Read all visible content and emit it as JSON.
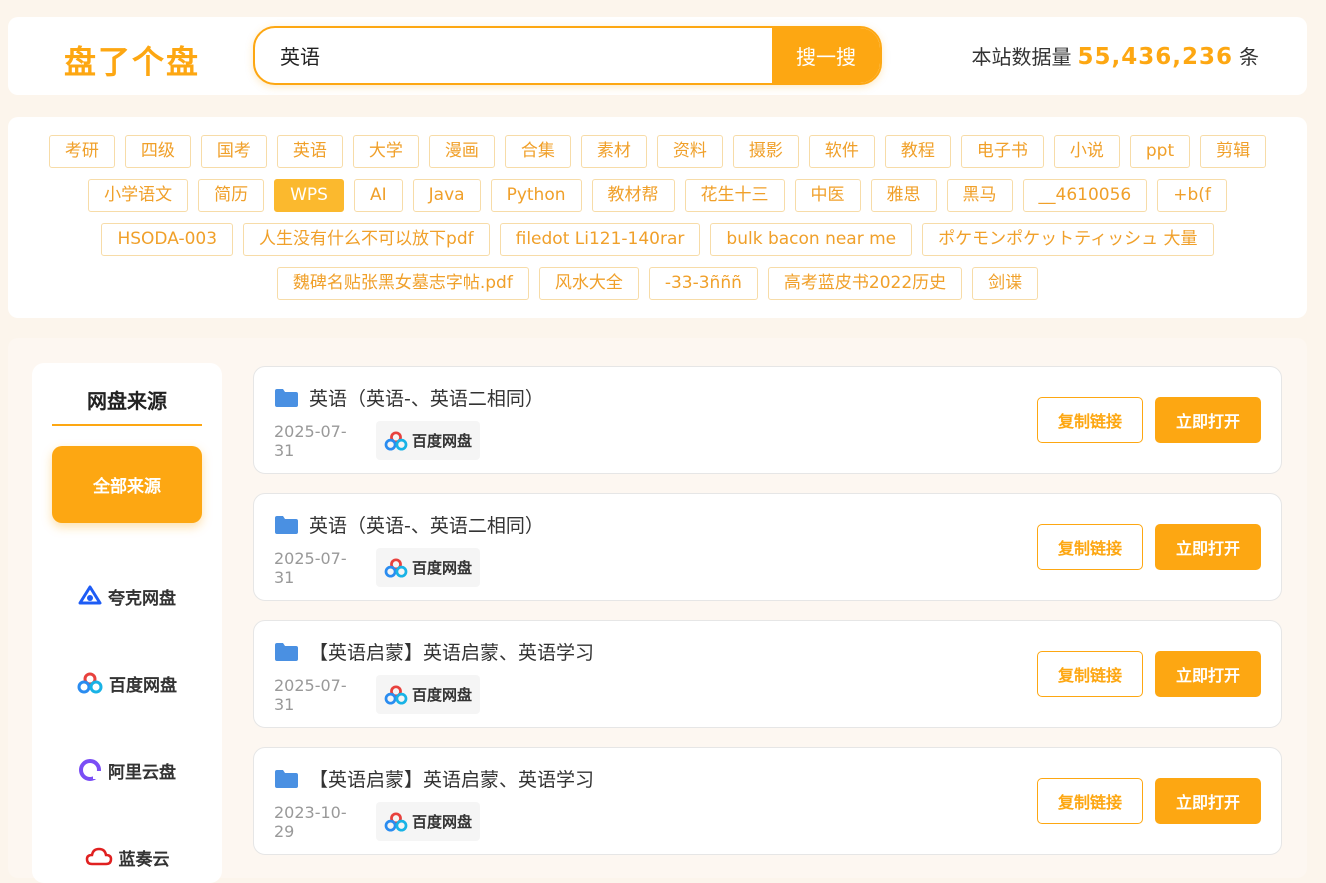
{
  "header": {
    "logo": "盘了个盘",
    "search_value": "英语",
    "search_button": "搜一搜",
    "stats_prefix": "本站数据量",
    "stats_count": "55,436,236",
    "stats_suffix": "条"
  },
  "tags": {
    "rows": [
      [
        "考研",
        "四级",
        "国考",
        "英语",
        "大学",
        "漫画",
        "合集",
        "素材",
        "资料",
        "摄影",
        "软件",
        "教程",
        "电子书",
        "小说",
        "ppt",
        "剪辑"
      ],
      [
        "小学语文",
        "简历",
        "WPS",
        "AI",
        "Java",
        "Python",
        "教材帮",
        "花生十三",
        "中医",
        "雅思",
        "黑马",
        "__4610056",
        "+b(f"
      ],
      [
        "HSODA-003",
        "人生没有什么不可以放下pdf",
        "filedot Li121-140rar",
        "bulk bacon near me",
        "ポケモンポケットティッシュ 大量"
      ],
      [
        "魏碑名贴张黑女墓志字帖.pdf",
        "风水大全",
        "-33-3ñññ",
        "高考蓝皮书2022历史",
        "剑谍"
      ]
    ],
    "active": "WPS"
  },
  "sidebar": {
    "title": "网盘来源",
    "all_label": "全部来源",
    "sources": [
      {
        "label": "夸克网盘",
        "icon": "quark-icon"
      },
      {
        "label": "百度网盘",
        "icon": "baidu-icon"
      },
      {
        "label": "阿里云盘",
        "icon": "aliyun-icon"
      },
      {
        "label": "蓝奏云",
        "icon": "lanzou-icon"
      }
    ]
  },
  "results": [
    {
      "title": "英语（英语-、英语二相同）",
      "date": "2025-07-31",
      "source": "百度网盘"
    },
    {
      "title": "英语（英语-、英语二相同）",
      "date": "2025-07-31",
      "source": "百度网盘"
    },
    {
      "title": "【英语启蒙】英语启蒙、英语学习",
      "date": "2025-07-31",
      "source": "百度网盘"
    },
    {
      "title": "【英语启蒙】英语启蒙、英语学习",
      "date": "2023-10-29",
      "source": "百度网盘"
    }
  ],
  "actions": {
    "copy_label": "复制链接",
    "open_label": "立即打开"
  },
  "colors": {
    "accent": "#fda712",
    "tag_text": "#f0a02a",
    "folder": "#4a90e2"
  }
}
